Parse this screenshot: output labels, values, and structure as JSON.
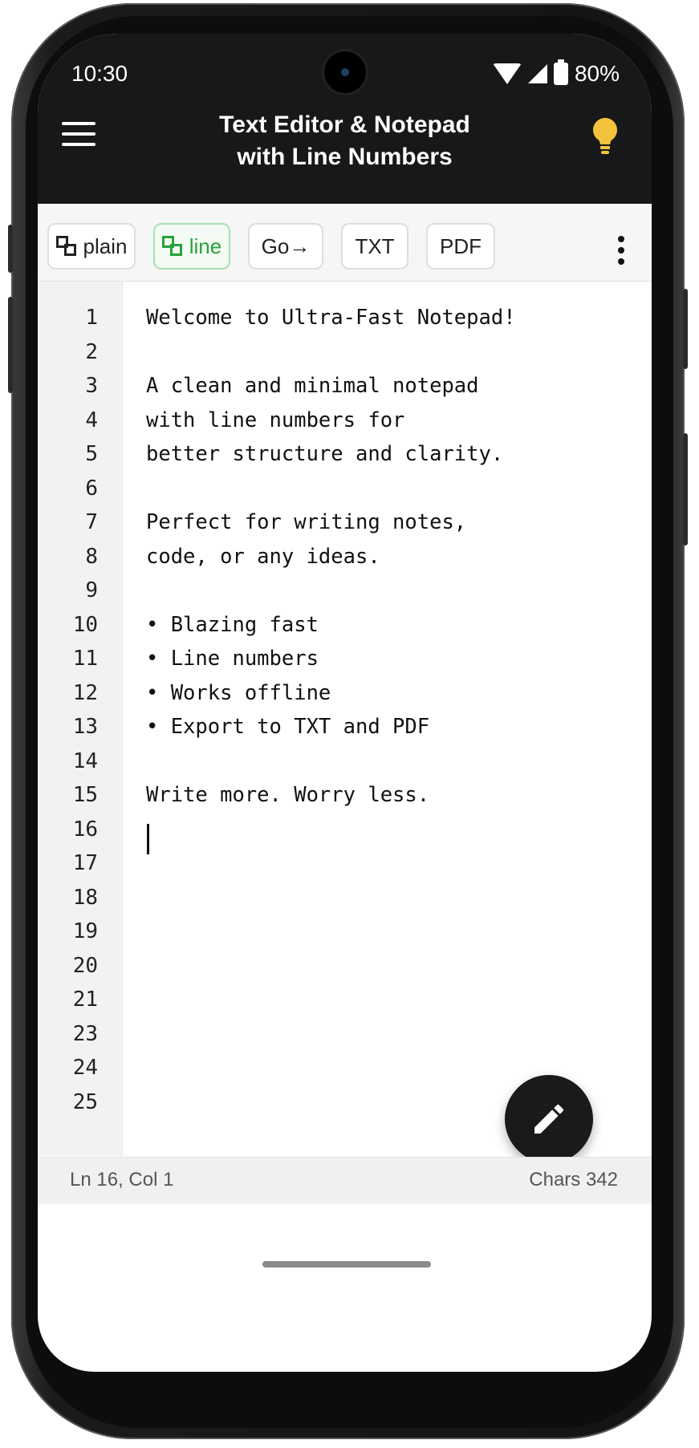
{
  "status": {
    "time": "10:30",
    "battery": "80%"
  },
  "app": {
    "title_line1": "Text Editor & Notepad",
    "title_line2": "with Line Numbers"
  },
  "toolbar": {
    "plain": "plain",
    "line": "line",
    "go": "Go→",
    "txt": "TXT",
    "pdf": "PDF"
  },
  "editor": {
    "line_numbers": [
      "1",
      "2",
      "3",
      "4",
      "5",
      "6",
      "7",
      "8",
      "9",
      "10",
      "11",
      "12",
      "13",
      "14",
      "15",
      "16",
      "17",
      "18",
      "19",
      "20",
      "21",
      "23",
      "24",
      "25"
    ],
    "lines": [
      "Welcome to Ultra-Fast Notepad!",
      "",
      "A clean and minimal notepad",
      "with line numbers for",
      "better structure and clarity.",
      "",
      "Perfect for writing notes,",
      "code, or any ideas.",
      "",
      "• Blazing fast",
      "• Line numbers",
      "• Works offline",
      "• Export to TXT and PDF",
      "",
      "Write more. Worry less."
    ]
  },
  "footer": {
    "position": "Ln 16, Col 1",
    "chars": "Chars 342"
  },
  "colors": {
    "topbar": "#16181a",
    "accent_green": "#25a33a",
    "bulb": "#f5c33b"
  },
  "icons": [
    "menu-icon",
    "lightbulb-icon",
    "copy-icon",
    "more-vert-icon",
    "pencil-icon"
  ]
}
